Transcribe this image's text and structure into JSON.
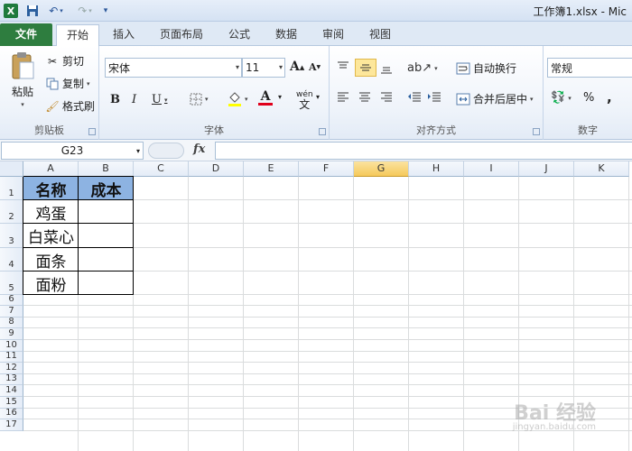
{
  "window": {
    "title": "工作簿1.xlsx - Mic"
  },
  "quick_access": {
    "logo": "X",
    "save_icon": "save-icon",
    "undo_icon": "undo-icon",
    "redo_icon": "redo-icon",
    "customize_icon": "customize-icon"
  },
  "tabs": [
    "文件",
    "开始",
    "插入",
    "页面布局",
    "公式",
    "数据",
    "审阅",
    "视图"
  ],
  "ribbon": {
    "clipboard": {
      "label": "剪贴板",
      "paste": "粘贴",
      "cut": "剪切",
      "copy": "复制",
      "format_painter": "格式刷"
    },
    "font": {
      "label": "字体",
      "font_name": "宋体",
      "font_size": "11",
      "grow": "A",
      "shrink": "A",
      "bold": "B",
      "italic": "I",
      "underline": "U",
      "font_color_letter": "A",
      "phonetic": "wén"
    },
    "alignment": {
      "label": "对齐方式",
      "wrap": "自动换行",
      "merge": "合并后居中"
    },
    "number": {
      "label": "数字",
      "format": "常规",
      "percent": "%",
      "comma": ","
    }
  },
  "formula_bar": {
    "name_box": "G23",
    "fx": "fx",
    "formula": ""
  },
  "grid": {
    "columns": [
      "A",
      "B",
      "C",
      "D",
      "E",
      "F",
      "G",
      "H",
      "I",
      "J",
      "K"
    ],
    "active_column": "G",
    "rows": [
      "1",
      "2",
      "3",
      "4",
      "5",
      "6",
      "7",
      "8",
      "9",
      "10",
      "11",
      "12",
      "13",
      "14",
      "15",
      "16",
      "17"
    ],
    "table": {
      "headers": [
        "名称",
        "成本"
      ],
      "header_fill": "#8db3e2",
      "rows": [
        [
          "鸡蛋",
          ""
        ],
        [
          "白菜心",
          ""
        ],
        [
          "面条",
          ""
        ],
        [
          "面粉",
          ""
        ]
      ]
    }
  },
  "watermark": {
    "main": "Bai 经验",
    "sub": "jingyan.baidu.com"
  }
}
